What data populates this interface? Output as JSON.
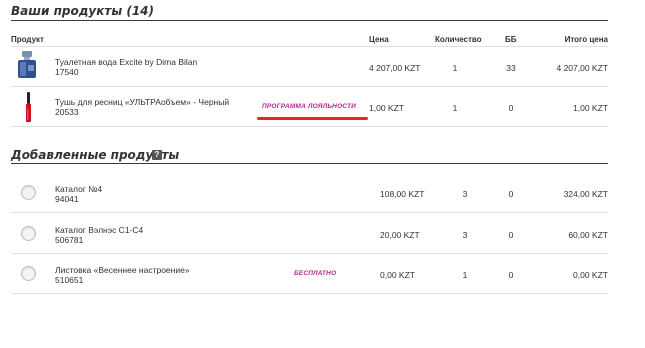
{
  "your_products": {
    "title": "Ваши продукты (14)",
    "headers": {
      "product": "Продукт",
      "price": "Цена",
      "quantity": "Количество",
      "bb": "ББ",
      "total": "Итого цена"
    },
    "items": [
      {
        "name": "Туалетная вода Excite by Dima Bilan",
        "code": "17540",
        "tag": "",
        "price": "4 207,00 KZT",
        "quantity": "1",
        "bb": "33",
        "total": "4 207,00 KZT",
        "thumbnail": "perfume-bottle-icon"
      },
      {
        "name": "Тушь для ресниц «УЛЬТРАобъем» - Черный",
        "code": "20533",
        "tag": "ПРОГРАММА ЛОЯЛЬНОСТИ",
        "price": "1,00 KZT",
        "quantity": "1",
        "bb": "0",
        "total": "1,00 KZT",
        "thumbnail": "mascara-icon"
      }
    ]
  },
  "added_products": {
    "title": "Добавленные продукты",
    "help_icon": "?",
    "items": [
      {
        "name": "Каталог №4",
        "code": "94041",
        "tag": "",
        "price": "108,00 KZT",
        "quantity": "3",
        "bb": "0",
        "total": "324,00 KZT"
      },
      {
        "name": "Каталог Вэлнэс С1-С4",
        "code": "506781",
        "tag": "",
        "price": "20,00 KZT",
        "quantity": "3",
        "bb": "0",
        "total": "60,00 KZT"
      },
      {
        "name": "Листовка «Весеннее настроение»",
        "code": "510651",
        "tag": "БЕСПЛАТНО",
        "price": "0,00 KZT",
        "quantity": "1",
        "bb": "0",
        "total": "0,00 KZT"
      }
    ]
  },
  "colors": {
    "tag": "#b0298c",
    "highlight_underline": "#e1262c"
  }
}
